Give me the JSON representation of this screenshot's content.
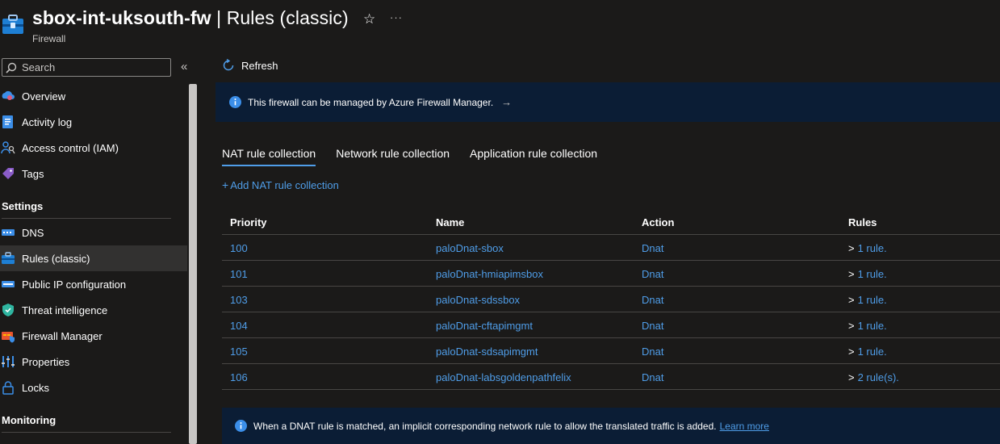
{
  "header": {
    "resource_name": "sbox-int-uksouth-fw",
    "page_name": " | Rules (classic)",
    "resource_type": "Firewall",
    "star_glyph": "☆",
    "more_glyph": "···"
  },
  "sidebar": {
    "search_placeholder": "Search",
    "collapse_glyph": "«",
    "items": [
      {
        "label": "Overview",
        "icon": "overview-icon"
      },
      {
        "label": "Activity log",
        "icon": "activity-log-icon"
      },
      {
        "label": "Access control (IAM)",
        "icon": "iam-icon"
      },
      {
        "label": "Tags",
        "icon": "tag-icon"
      }
    ],
    "settings_title": "Settings",
    "settings_items": [
      {
        "label": "DNS",
        "icon": "dns-icon"
      },
      {
        "label": "Rules (classic)",
        "icon": "firewall-icon",
        "active": true
      },
      {
        "label": "Public IP configuration",
        "icon": "public-ip-icon"
      },
      {
        "label": "Threat intelligence",
        "icon": "shield-icon"
      },
      {
        "label": "Firewall Manager",
        "icon": "firewall-manager-icon"
      },
      {
        "label": "Properties",
        "icon": "properties-icon"
      },
      {
        "label": "Locks",
        "icon": "lock-icon"
      }
    ],
    "monitoring_title": "Monitoring"
  },
  "toolbar": {
    "refresh_label": "Refresh"
  },
  "banner": {
    "text": "This firewall can be managed by Azure Firewall Manager.",
    "arrow": "→"
  },
  "tabs": [
    {
      "label": "NAT rule collection",
      "active": true
    },
    {
      "label": "Network rule collection"
    },
    {
      "label": "Application rule collection"
    }
  ],
  "add_link": {
    "plus": "+",
    "label": "Add NAT rule collection"
  },
  "table": {
    "columns": [
      "Priority",
      "Name",
      "Action",
      "Rules"
    ],
    "rows": [
      {
        "priority": "100",
        "name": "paloDnat-sbox",
        "action": "Dnat",
        "rules": "1 rule."
      },
      {
        "priority": "101",
        "name": "paloDnat-hmiapimsbox",
        "action": "Dnat",
        "rules": "1 rule."
      },
      {
        "priority": "103",
        "name": "paloDnat-sdssbox",
        "action": "Dnat",
        "rules": "1 rule."
      },
      {
        "priority": "104",
        "name": "paloDnat-cftapimgmt",
        "action": "Dnat",
        "rules": "1 rule."
      },
      {
        "priority": "105",
        "name": "paloDnat-sdsapimgmt",
        "action": "Dnat",
        "rules": "1 rule."
      },
      {
        "priority": "106",
        "name": "paloDnat-labsgoldenpathfelix",
        "action": "Dnat",
        "rules": "2 rule(s)."
      }
    ]
  },
  "footer_banner": {
    "text": "When a DNAT rule is matched, an implicit corresponding network rule to allow the translated traffic is added.",
    "link": "Learn more"
  },
  "colors": {
    "background": "#1b1a19",
    "link": "#4f9de8",
    "banner": "#0b1d35",
    "active_nav": "#323130"
  }
}
